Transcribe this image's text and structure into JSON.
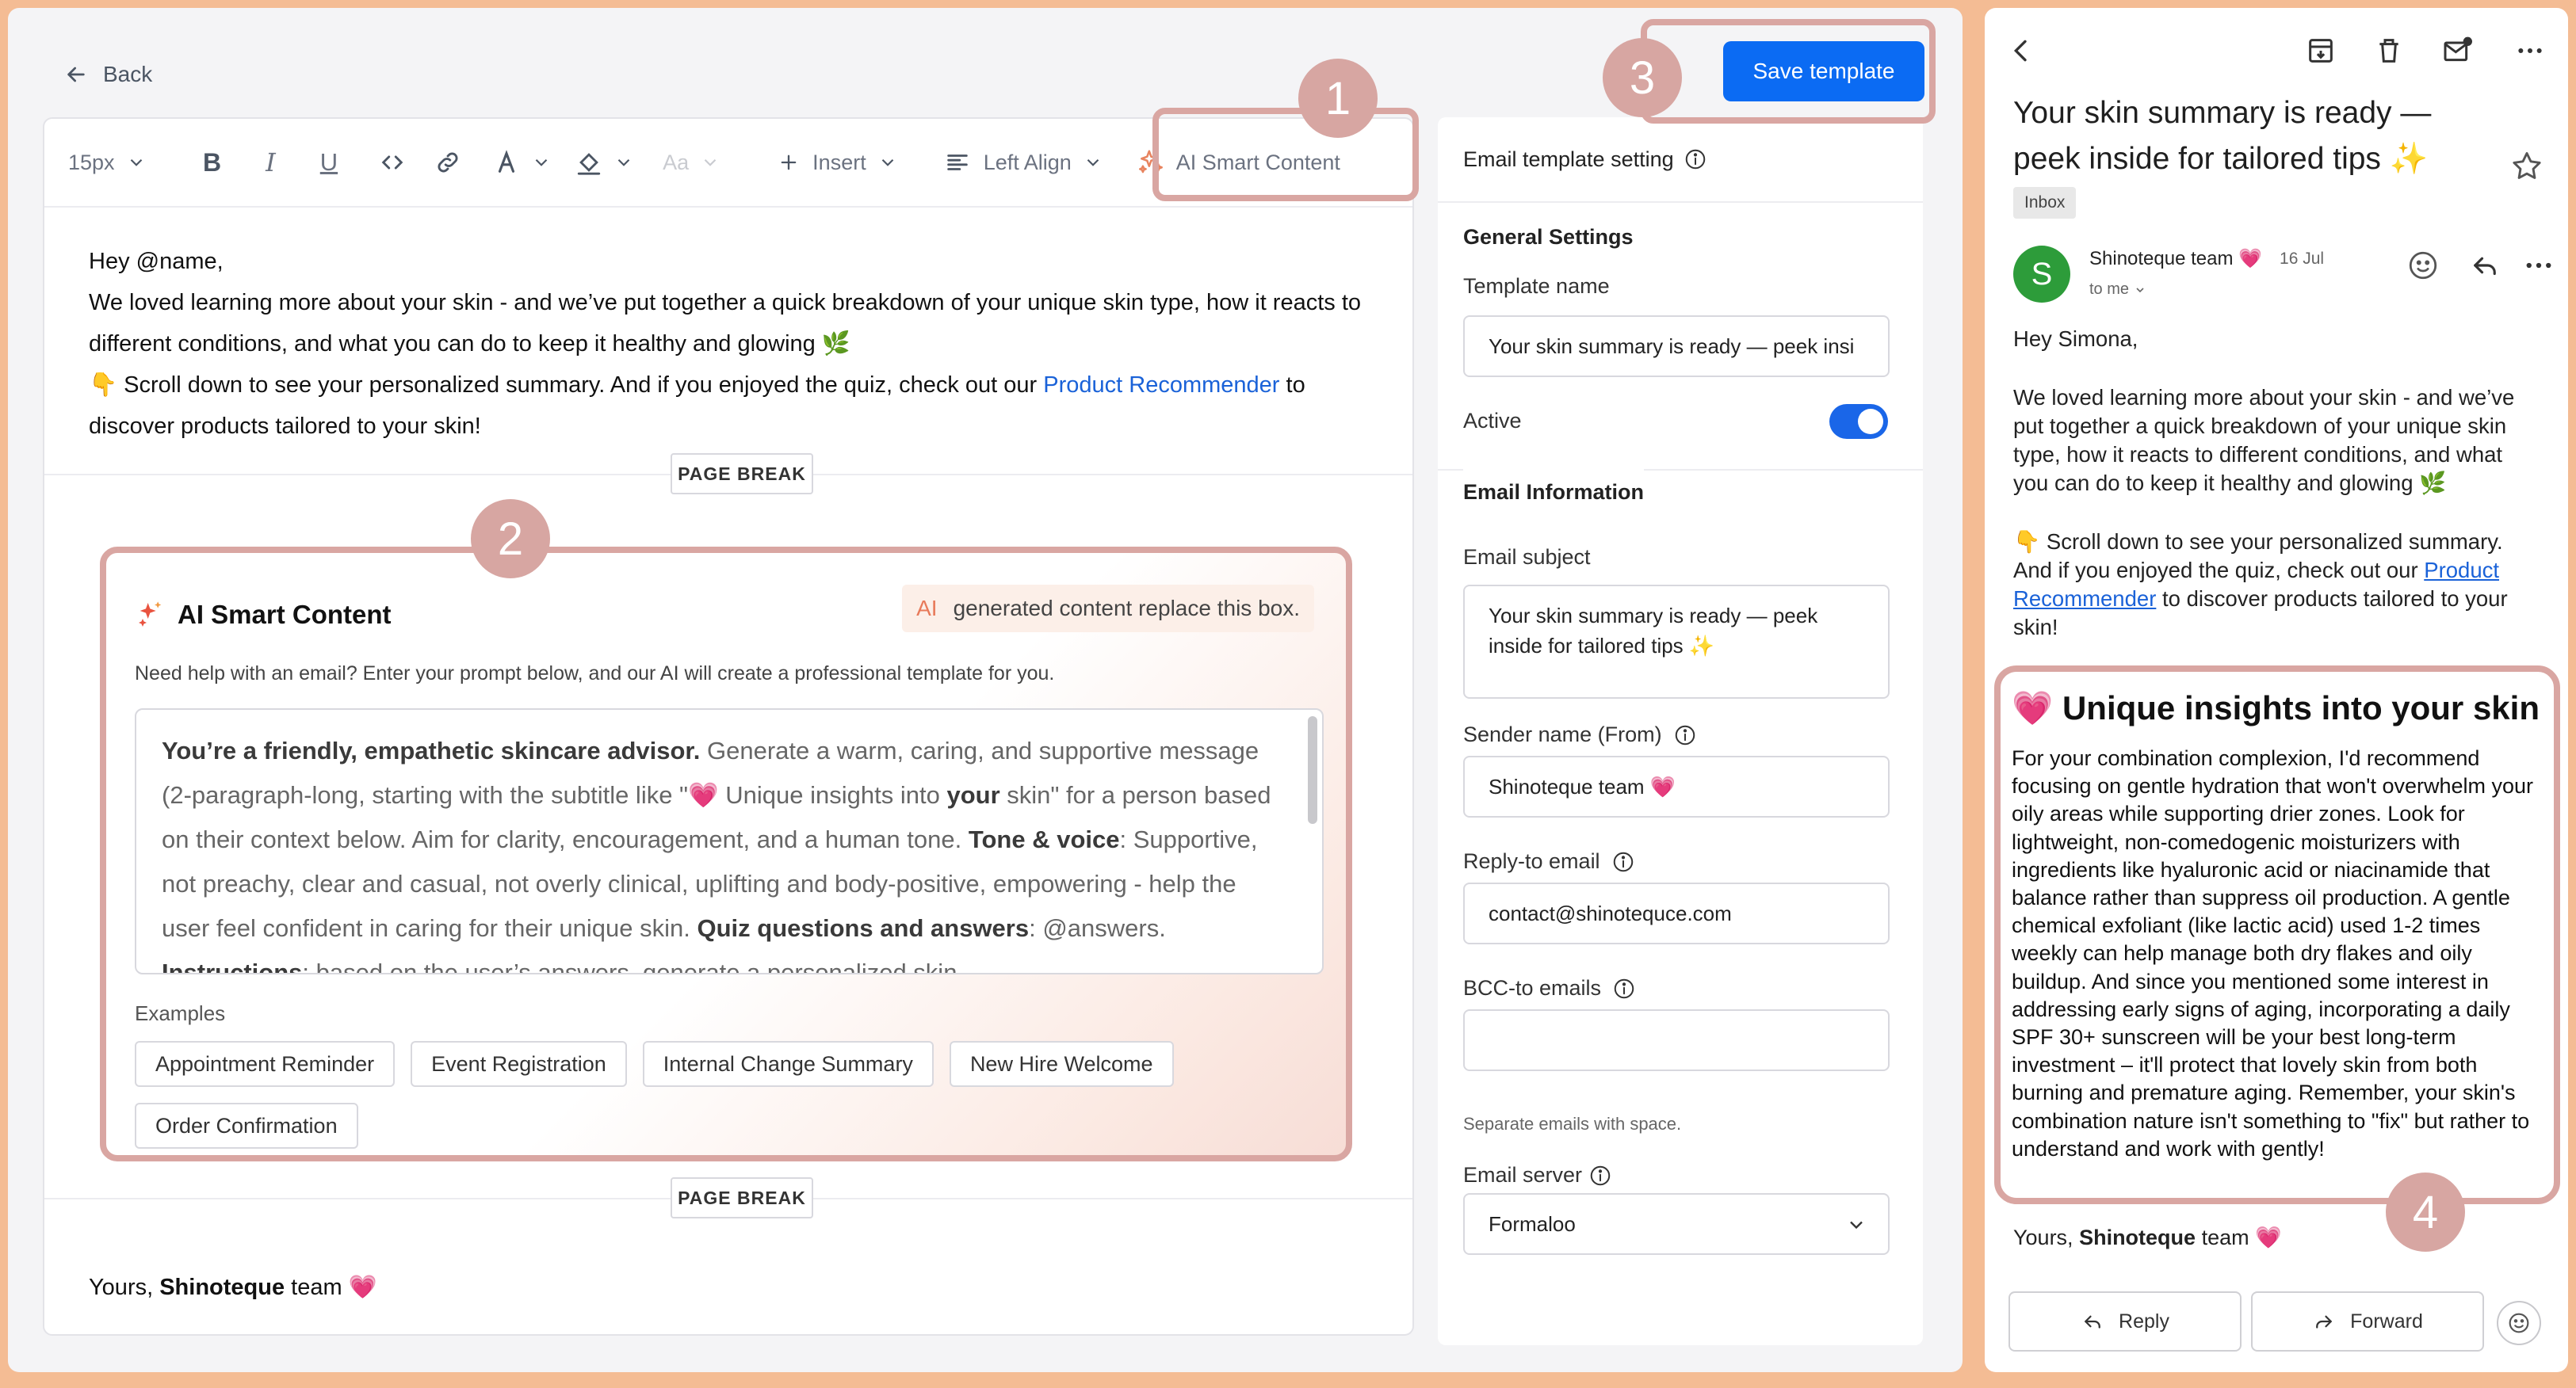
{
  "header": {
    "back_label": "Back",
    "save_label": "Save template"
  },
  "toolbar": {
    "font_size": "15px",
    "aa_label": "Aa",
    "insert_label": "Insert",
    "align_label": "Left Align",
    "ai_label": "AI Smart Content"
  },
  "editor": {
    "greeting": "Hey @name,",
    "para1": "We loved learning more about your skin - and we’ve put together a quick breakdown of your unique skin type, how it reacts to different conditions, and what you can do to keep it healthy and glowing 🌿",
    "para2_pre": "👇 Scroll down to see your personalized summary. And if you enjoyed the quiz, check out our ",
    "para2_link": "Product Recommender",
    "para2_post": " to discover products tailored to your skin!",
    "page_break": "PAGE BREAK",
    "closing_pre": "Yours, ",
    "closing_name": "Shinoteque",
    "closing_post": " team 💗"
  },
  "ai_box": {
    "title": "AI Smart Content",
    "badge_ai": "AI",
    "badge_text": "generated content replace this box.",
    "help": "Need help with an email? Enter your prompt below, and our AI will create a professional template for you.",
    "prompt_b1": "You’re a friendly, empathetic skincare advisor.",
    "prompt_t1": " Generate a warm, caring, and supportive message (2-paragraph-long, starting with the subtitle like \"💗 Unique insights into ",
    "prompt_b2": "your",
    "prompt_t2": " skin\" for a person based on their context below. Aim for clarity, encouragement, and a human tone. ",
    "prompt_b3": "Tone & voice",
    "prompt_t3": ": Supportive, not preachy, clear and casual, not overly clinical, uplifting and body-positive, empowering - help the user feel confident in caring for their unique skin. ",
    "prompt_b4": "Quiz questions and answers",
    "prompt_t4": ": @answers. ",
    "prompt_b5": "Instructions",
    "prompt_t5": ": based on the user’s answers, generate a personalized skin",
    "examples_label": "Examples",
    "examples": [
      "Appointment Reminder",
      "Event Registration",
      "Internal Change Summary",
      "New Hire Welcome",
      "Order Confirmation"
    ]
  },
  "settings": {
    "header": "Email template setting",
    "general_title": "General Settings",
    "template_name_label": "Template name",
    "template_name_value": "Your skin summary is ready — peek insi",
    "active_label": "Active",
    "email_info_title": "Email Information",
    "subject_label": "Email subject",
    "subject_value": "Your skin summary is ready — peek inside for tailored tips ✨",
    "sender_label": "Sender name (From)",
    "sender_value": "Shinoteque team 💗",
    "reply_label": "Reply-to email",
    "reply_value": "contact@shinotequce.com",
    "bcc_label": "BCC-to emails",
    "bcc_value": "",
    "bcc_hint": "Separate emails with space.",
    "server_label": "Email server",
    "server_value": "Formaloo"
  },
  "badges": {
    "one": "1",
    "two": "2",
    "three": "3",
    "four": "4"
  },
  "email": {
    "subject": "Your skin summary is ready — peek inside for tailored tips ✨",
    "inbox_tag": "Inbox",
    "avatar_letter": "S",
    "sender": "Shinoteque team 💗",
    "date": "16 Jul",
    "to": "to me",
    "greeting": "Hey Simona,",
    "para1": "We loved learning more about your skin - and we’ve put together a quick breakdown of your unique skin type, how it reacts to different conditions, and what you can do to keep it healthy and glowing 🌿",
    "para2_pre": "👇 Scroll down to see your personalized summary. And if you enjoyed the quiz, check out our ",
    "para2_link": "Product Recommender",
    "para2_post": " to discover products tailored to your skin!",
    "insight_title": "💗 Unique insights into your skin",
    "insight_text": "For your combination complexion, I'd recommend focusing on gentle hydration that won't overwhelm your oily areas while supporting drier zones. Look for lightweight, non-comedogenic moisturizers with ingredients like hyaluronic acid or niacinamide that balance rather than suppress oil production. A gentle chemical exfoliant (like lactic acid) used 1-2 times weekly can help manage both dry flakes and oily buildup. And since you mentioned some interest in addressing early signs of aging, incorporating a daily SPF 30+ sunscreen will be your best long-term investment – it'll protect that lovely skin from both burning and premature aging. Remember, your skin's combination nature isn't something to \"fix\" but rather to understand and work with gently!",
    "closing_pre": "Yours, ",
    "closing_name": "Shinoteque",
    "closing_post": " team 💗",
    "reply_label": "Reply",
    "forward_label": "Forward"
  }
}
